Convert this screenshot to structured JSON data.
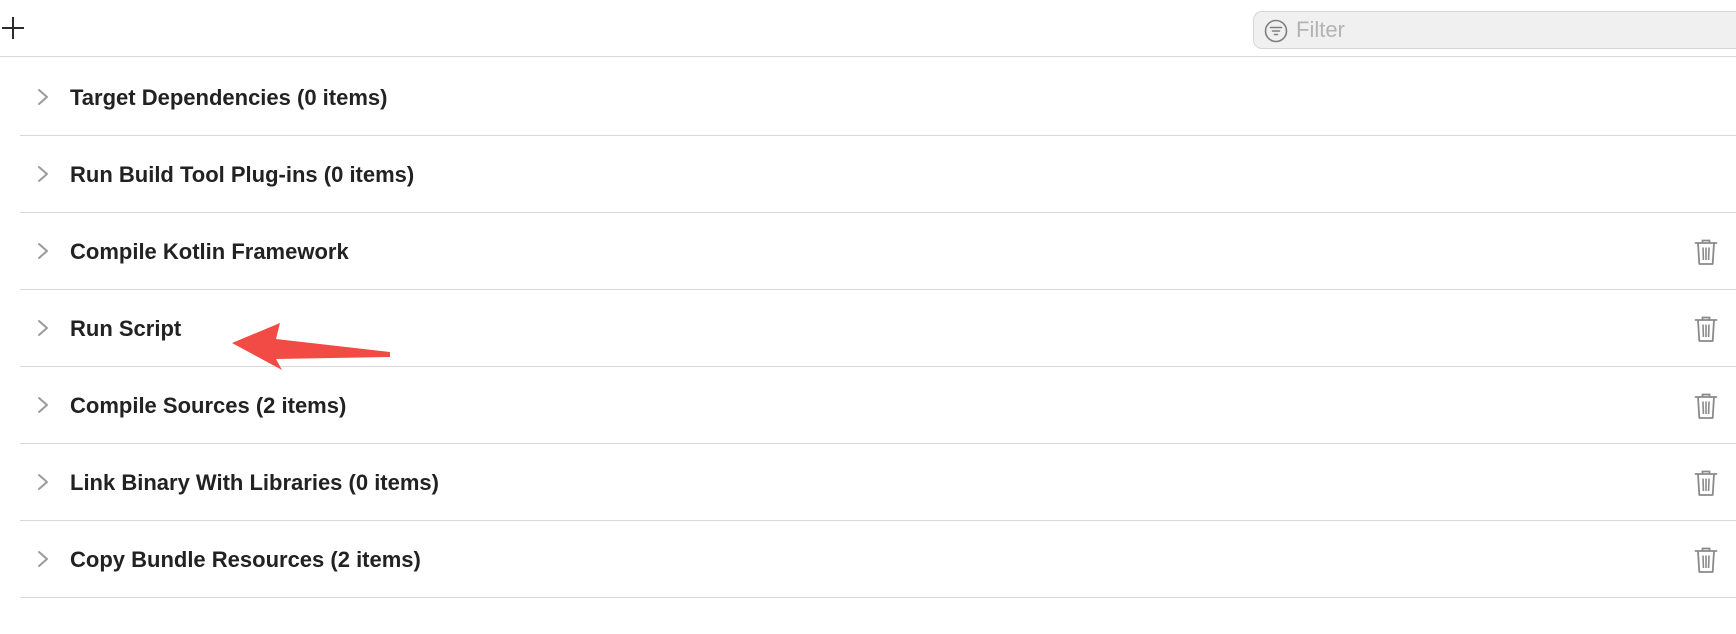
{
  "toolbar": {
    "add_icon": "plus-icon",
    "filter": {
      "placeholder": "Filter",
      "value": "",
      "icon": "filter-icon"
    }
  },
  "phases": [
    {
      "label": "Target Dependencies (0 items)",
      "deletable": false
    },
    {
      "label": "Run Build Tool Plug-ins (0 items)",
      "deletable": false
    },
    {
      "label": "Compile Kotlin Framework",
      "deletable": true
    },
    {
      "label": "Run Script",
      "deletable": true
    },
    {
      "label": "Compile Sources (2 items)",
      "deletable": true
    },
    {
      "label": "Link Binary With Libraries (0 items)",
      "deletable": true
    },
    {
      "label": "Copy Bundle Resources (2 items)",
      "deletable": true
    }
  ],
  "annotation": {
    "type": "arrow",
    "color": "#f24b45",
    "points_to": "Run Script"
  },
  "colors": {
    "divider": "#d9d9d9",
    "chevron": "#9a9a9a",
    "trash": "#8a8a8a",
    "filter_bg": "#f0f0f0"
  }
}
